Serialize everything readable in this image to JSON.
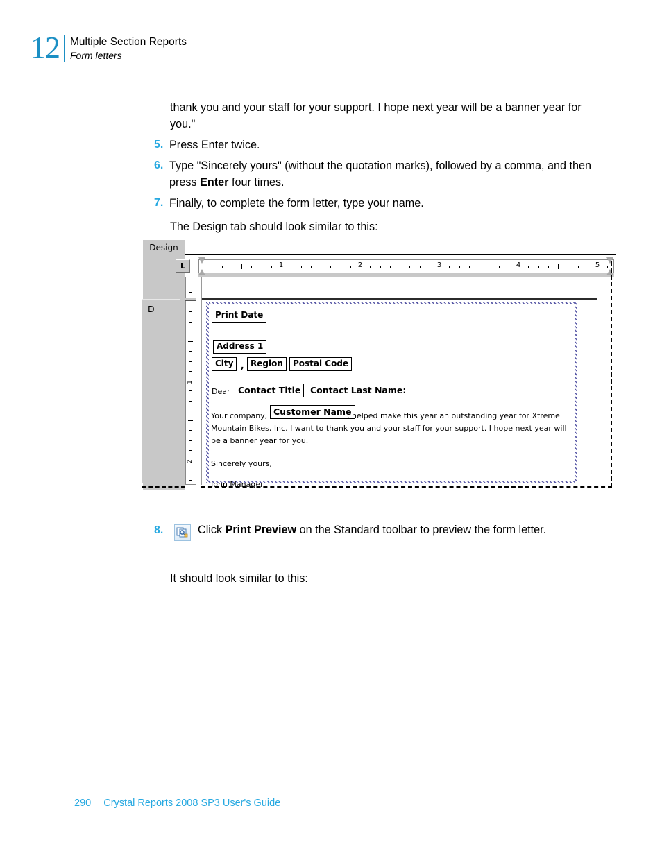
{
  "header": {
    "chapter_number": "12",
    "chapter_title": "Multiple Section Reports",
    "chapter_subtitle": "Form letters"
  },
  "body": {
    "continued_paragraph": "thank you and your staff for your support. I hope next year will be a banner year for you.\"",
    "steps": [
      {
        "num": "5.",
        "text": "Press Enter twice."
      },
      {
        "num": "6.",
        "text_before": "Type \"Sincerely yours\" (without the quotation marks), followed by a comma, and then press ",
        "bold": "Enter",
        "text_after": " four times."
      },
      {
        "num": "7.",
        "text": "Finally, to complete the form letter, type your name."
      }
    ],
    "design_tab_note": "The Design tab should look similar to this:",
    "step8": {
      "num": "8.",
      "icon": "print-preview-icon",
      "text_before": "Click ",
      "bold": "Print Preview",
      "text_after": " on the Standard toolbar to preview the form letter."
    },
    "preview_note": "It should look similar to this:"
  },
  "figure": {
    "tab_label": "Design",
    "tab_stop_button": "L",
    "section_label": "D",
    "ruler": {
      "horizontal_numbers": [
        "1",
        "2",
        "3",
        "4",
        "5"
      ],
      "vertical_numbers": [
        "1",
        "2"
      ]
    },
    "fields": {
      "print_date": "Print Date",
      "address1": "Address 1",
      "city": "City",
      "comma": ",",
      "region": "Region",
      "postal_code": "Postal Code",
      "dear": "Dear",
      "contact_title": "Contact Title",
      "contact_last_name": "Contact Last Name:",
      "customer_name": "Customer Name"
    },
    "letter": {
      "line1_before": "Your company,",
      "line1_after": ", helped make this year an outstanding year for Xtreme",
      "line2": "Mountain Bikes, Inc. I want to thank you and your staff for your support. I hope next year will",
      "line3": "be a banner year for you.",
      "closing": "Sincerely yours,",
      "signature": "John Manager"
    }
  },
  "footer": {
    "page_number": "290",
    "guide_title": "Crystal Reports 2008 SP3 User's Guide"
  },
  "colors": {
    "accent_blue": "#27a9e1",
    "chapter_blue": "#1b8fc4",
    "panel_gray": "#c8c8c8",
    "hatch_blue": "#5b5ba8"
  }
}
